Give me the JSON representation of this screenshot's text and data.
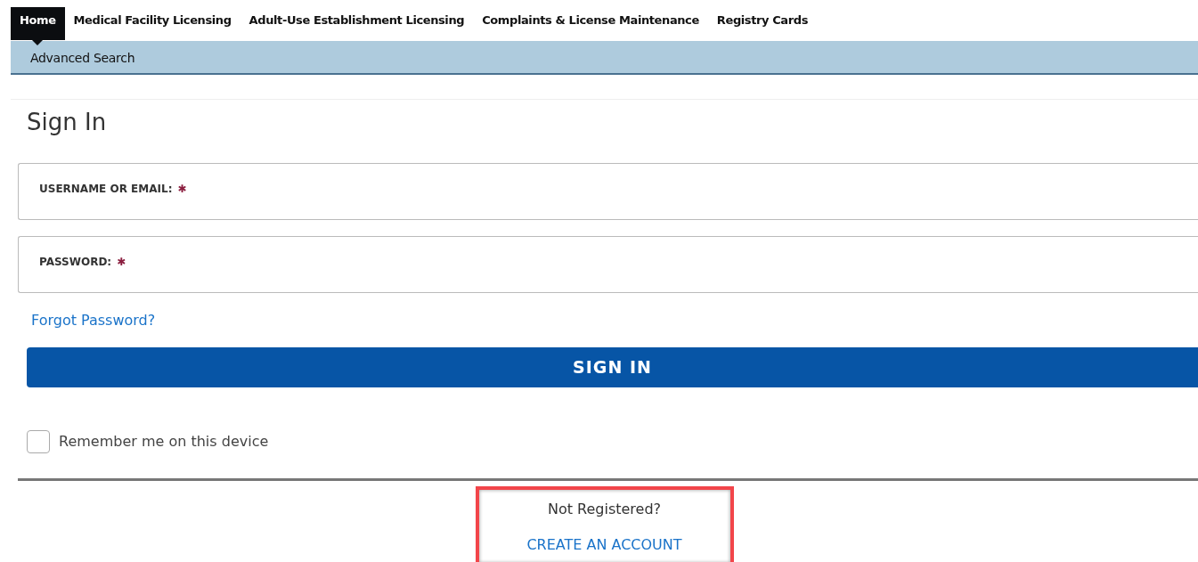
{
  "nav_tabs": [
    {
      "label": "Home",
      "selected": true
    },
    {
      "label": "Medical Facility Licensing",
      "selected": false
    },
    {
      "label": "Adult-Use Establishment Licensing",
      "selected": false
    },
    {
      "label": "Complaints & License Maintenance",
      "selected": false
    },
    {
      "label": "Registry Cards",
      "selected": false
    }
  ],
  "sub_nav": {
    "items": [
      "Advanced Search"
    ]
  },
  "sign_in": {
    "title": "Sign In",
    "fields": [
      {
        "label": "USERNAME OR EMAIL:",
        "required": true,
        "required_mark": "✱"
      },
      {
        "label": "PASSWORD:",
        "required": true,
        "required_mark": "✱"
      }
    ],
    "forgot_link": "Forgot Password?",
    "submit": "SIGN IN",
    "remember": {
      "label": "Remember me on this device",
      "checked": false
    }
  },
  "register": {
    "prompt": "Not Registered?",
    "link": "CREATE AN ACCOUNT",
    "highlighted": true
  }
}
